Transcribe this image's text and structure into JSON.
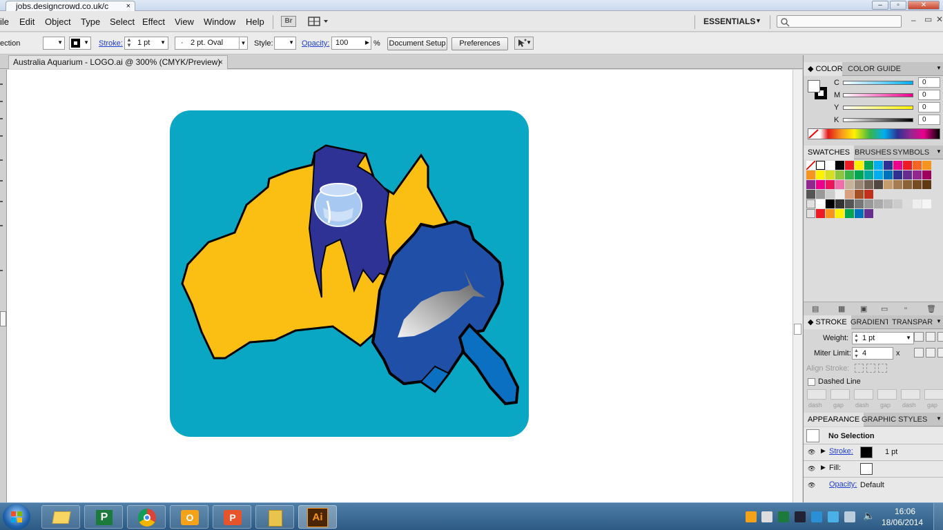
{
  "browser": {
    "tab_title": "jobs.designcrowd.co.uk/c",
    "close_glyph": "×"
  },
  "menubar": {
    "items": [
      "ile",
      "Edit",
      "Object",
      "Type",
      "Select",
      "Effect",
      "View",
      "Window",
      "Help"
    ],
    "bridge": "Br",
    "workspace": "ESSENTIALS"
  },
  "controlbar": {
    "selection_fragment": "ection",
    "stroke_label": "Stroke:",
    "stroke_value": "1 pt",
    "brush_value": "2 pt. Oval",
    "style_label": "Style:",
    "opacity_label": "Opacity:",
    "opacity_value": "100",
    "percent": "%",
    "document_setup": "Document Setup",
    "preferences": "Preferences"
  },
  "document": {
    "tab_title": "Australia Aquarium - LOGO.ai @ 300% (CMYK/Preview)",
    "close_glyph": "×"
  },
  "color_panel": {
    "tabs": [
      "COLOR",
      "COLOR GUIDE"
    ],
    "channels": [
      {
        "name": "C",
        "value": "0",
        "color": "#00aeef"
      },
      {
        "name": "M",
        "value": "0",
        "color": "#ec008c"
      },
      {
        "name": "Y",
        "value": "0",
        "color": "#fff200"
      },
      {
        "name": "K",
        "value": "0",
        "color": "#000000"
      }
    ]
  },
  "swatches_panel": {
    "tabs": [
      "SWATCHES",
      "BRUSHES",
      "SYMBOLS"
    ]
  },
  "stroke_panel": {
    "tabs": [
      "STROKE",
      "GRADIENT",
      "TRANSPAR"
    ],
    "weight_label": "Weight:",
    "weight_value": "1 pt",
    "miter_label": "Miter Limit:",
    "miter_value": "4",
    "miter_unit": "x",
    "align_label": "Align Stroke:",
    "dashed_label": "Dashed Line",
    "dash_labels": [
      "dash",
      "gap",
      "dash",
      "gap",
      "dash",
      "gap"
    ]
  },
  "appearance_panel": {
    "tabs": [
      "APPEARANCE",
      "GRAPHIC STYLES"
    ],
    "title": "No Selection",
    "stroke_label": "Stroke:",
    "stroke_value": "1 pt",
    "fill_label": "Fill:",
    "opacity_label": "Opacity:",
    "opacity_value": "Default"
  },
  "taskbar": {
    "time": "16:06",
    "date": "18/06/2014",
    "apps": [
      "windows-explorer",
      "publisher",
      "chrome",
      "outlook",
      "powerpoint",
      "folder",
      "illustrator"
    ],
    "ai_label": "Ai"
  }
}
